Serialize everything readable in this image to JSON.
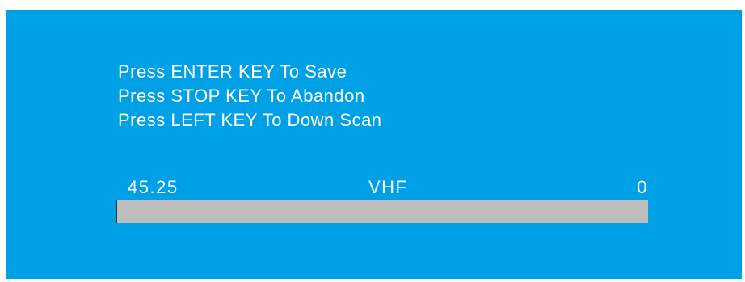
{
  "instructions": [
    "Press ENTER KEY To Save",
    "Press STOP KEY To Abandon",
    "Press LEFT KEY To Down Scan"
  ],
  "scan": {
    "frequency": "45.25",
    "band": "VHF",
    "level": "0",
    "progress": 0
  },
  "colors": {
    "background": "#00a0e6",
    "text": "#ffffff",
    "bar_track": "#bebebe"
  }
}
